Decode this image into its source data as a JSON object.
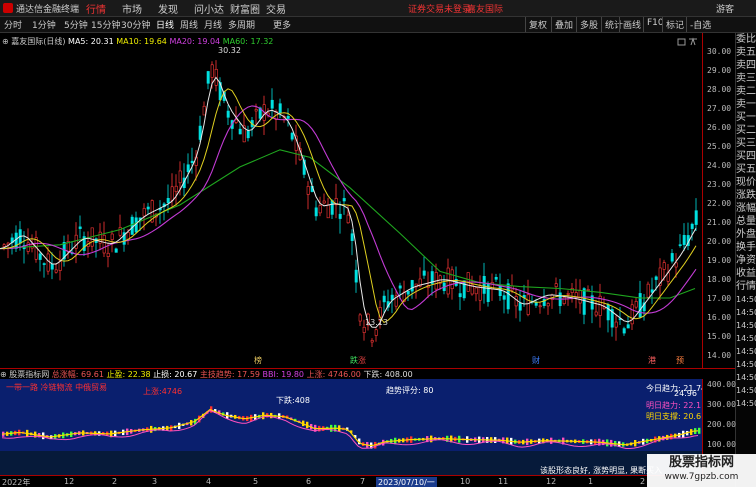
{
  "app": {
    "name": "通达信金融终端"
  },
  "menu": [
    "行情",
    "市场",
    "发现",
    "问小达",
    "财富圈",
    "交易"
  ],
  "notice": {
    "login": "证券交易未登录",
    "broker": "嘉友国际",
    "guest": "游客"
  },
  "timeframes": [
    "分时",
    "1分钟",
    "5分钟",
    "15分钟",
    "30分钟",
    "日线",
    "周线",
    "月线",
    "多周期",
    "更多"
  ],
  "tool_buttons": [
    "复权",
    "叠加",
    "多股",
    "统计",
    "画线",
    "F10",
    "标记",
    "-自选"
  ],
  "stock": {
    "name": "嘉友国际(日线)",
    "ma5": "MA5: 20.31",
    "ma10": "MA10: 19.64",
    "ma20": "MA20: 19.04",
    "ma60": "MA60: 17.32"
  },
  "price_axis": [
    "30.00",
    "29.00",
    "28.00",
    "27.00",
    "26.00",
    "25.00",
    "24.00",
    "23.00",
    "22.00",
    "21.00",
    "20.00",
    "19.00",
    "18.00",
    "17.00",
    "16.00",
    "15.00",
    "14.00"
  ],
  "annotations": {
    "high": "30.32",
    "low": "13.13"
  },
  "markers": [
    "榜",
    "跌",
    "涨",
    "财",
    "港",
    "预"
  ],
  "right_panel": [
    "委比",
    "卖五",
    "卖四",
    "卖三",
    "卖二",
    "卖一",
    "买一",
    "买二",
    "买三",
    "买四",
    "买五",
    "现价",
    "涨跌",
    "涨幅",
    "总量",
    "外盘",
    "换手",
    "净资",
    "收益",
    "行情"
  ],
  "right_times": [
    "14:50",
    "14:50",
    "14:50",
    "14:50",
    "14:50",
    "14:50",
    "14:50",
    "14:50",
    "14:50"
  ],
  "indicator": {
    "name": "股票指标网",
    "zdf": "总涨幅: 69.61",
    "zy": "止盈: 22.38",
    "zs": "止损: 20.67",
    "trend": "主技趋势: 17.59",
    "bbi": "BBI: 19.80",
    "up": "上涨: 4746.00",
    "down": "下跌: 408.00",
    "slogan": "一带一路 冷链物流 中俄贸易",
    "up_label": "上涨:4746",
    "down_label": "下跌:408",
    "score": "趋势评分: 80",
    "power_today": "今日趋力: 21.74",
    "power_val": "24.96",
    "power_tomorrow": "明日趋力: 22.1",
    "support_tomorrow": "明日支撑: 20.6",
    "hint": "该股形态良好, 涨势明显, 果断买入",
    "axis": [
      "400.00",
      "300.00",
      "200.00",
      "100.00",
      "0.00"
    ],
    "dimx": "0.00"
  },
  "dates": [
    "2022年",
    "12",
    "2",
    "3",
    "4",
    "5",
    "6",
    "7",
    "2023/07/10/一",
    "10",
    "11",
    "12",
    "1",
    "2"
  ],
  "watermark": {
    "title": "股票指标网",
    "url": "www.7gpzb.com"
  }
}
